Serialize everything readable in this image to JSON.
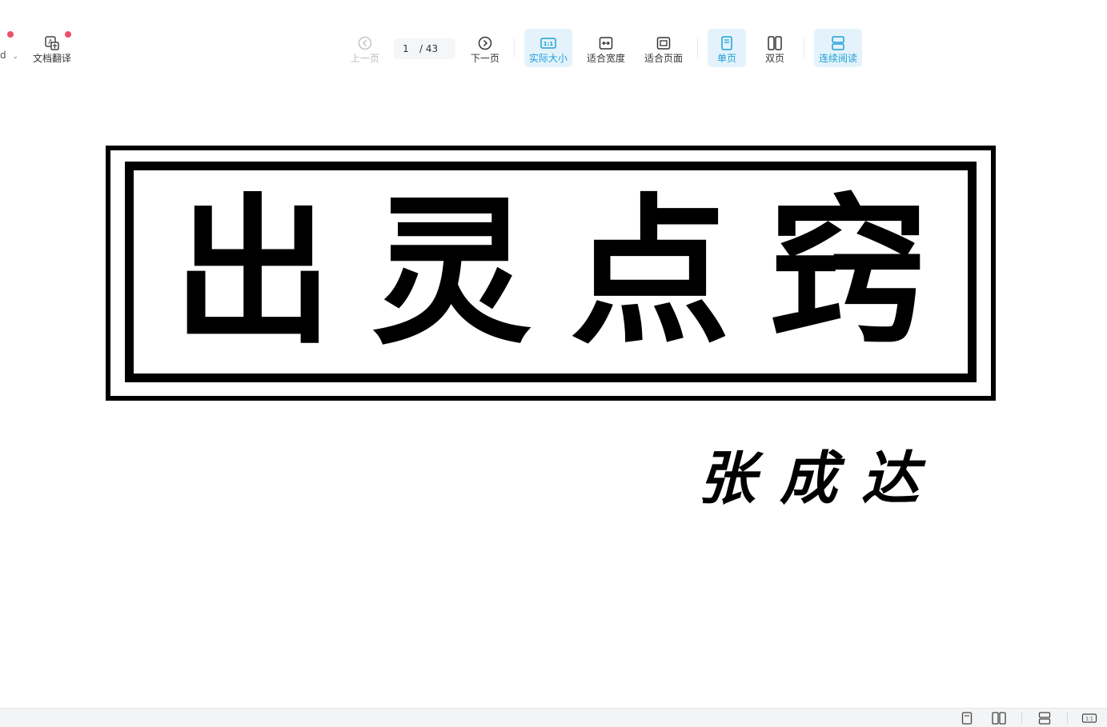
{
  "toolbar": {
    "left_cut_label": "d",
    "doc_translate": "文档翻译",
    "prev_page": "上一页",
    "next_page": "下一页",
    "current_page": "1",
    "total_pages": "/ 43",
    "actual_size": "实际大小",
    "fit_width": "适合宽度",
    "fit_page": "适合页面",
    "single_page": "单页",
    "double_page": "双页",
    "continuous_read": "连续阅读",
    "actual_size_icon_text": "1:1"
  },
  "document": {
    "title_chars": [
      "出",
      "灵",
      "点",
      "窍"
    ],
    "author_chars": [
      "张",
      "成",
      "达"
    ]
  },
  "statusbar": {
    "actual_size_icon_text": "1:1"
  },
  "colors": {
    "accent": "#1e9fd6",
    "active_bg": "#e4f3fb",
    "notify_dot": "#f04d6b"
  }
}
